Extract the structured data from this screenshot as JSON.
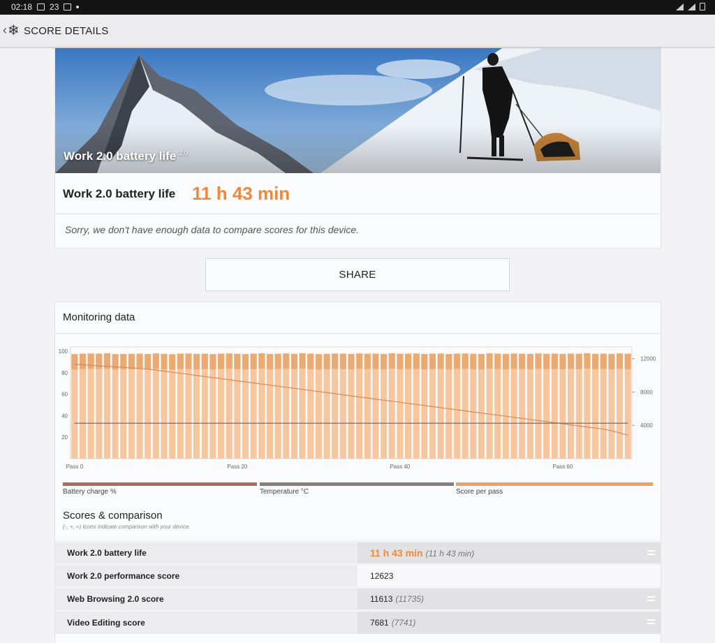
{
  "status_bar": {
    "time": "02:18",
    "notif_count": "23"
  },
  "app_bar": {
    "back_glyph": "‹",
    "logo_glyph": "❄",
    "title": "SCORE DETAILS"
  },
  "hero": {
    "caption": "Work 2.0 battery life",
    "caption_version": "2.0",
    "score_label": "Work 2.0 battery life",
    "score_value": "11 h 43 min",
    "compare_note": "Sorry, we don't have enough data to compare scores for this device."
  },
  "share": {
    "label": "SHARE"
  },
  "monitoring": {
    "title": "Monitoring data",
    "legend": [
      {
        "label": "Battery charge %",
        "color": "#a07060"
      },
      {
        "label": "Temperature °C",
        "color": "#8c7d7a"
      },
      {
        "label": "Score per pass",
        "color": "#f0a061"
      }
    ]
  },
  "chart_data": {
    "type": "bar",
    "x_tick_labels": [
      "Pass 0",
      "Pass 20",
      "Pass 40",
      "Pass 60"
    ],
    "x": [
      0,
      1,
      2,
      3,
      4,
      5,
      6,
      7,
      8,
      9,
      10,
      11,
      12,
      13,
      14,
      15,
      16,
      17,
      18,
      19,
      20,
      21,
      22,
      23,
      24,
      25,
      26,
      27,
      28,
      29,
      30,
      31,
      32,
      33,
      34,
      35,
      36,
      37,
      38,
      39,
      40,
      41,
      42,
      43,
      44,
      45,
      46,
      47,
      48,
      49,
      50,
      51,
      52,
      53,
      54,
      55,
      56,
      57,
      58,
      59,
      60,
      61,
      62,
      63,
      64,
      65,
      66,
      67,
      68
    ],
    "xlim": [
      -0.5,
      68.5
    ],
    "left_axis": {
      "ticks": [
        "100",
        "80",
        "60",
        "40",
        "20"
      ],
      "range": [
        0,
        104
      ]
    },
    "right_axis": {
      "ticks": [
        "12000",
        "8000",
        "4000"
      ],
      "range": [
        0,
        13400
      ]
    },
    "series": [
      {
        "name": "Score per pass",
        "axis": "right",
        "values": [
          12540,
          12590,
          12620,
          12600,
          12640,
          12540,
          12560,
          12580,
          12600,
          12550,
          12620,
          12570,
          12530,
          12600,
          12610,
          12560,
          12590,
          12540,
          12600,
          12620,
          12580,
          12550,
          12600,
          12640,
          12560,
          12590,
          12620,
          12580,
          12650,
          12600,
          12540,
          12570,
          12610,
          12590,
          12560,
          12620,
          12590,
          12600,
          12560,
          12640,
          12580,
          12600,
          12620,
          12560,
          12590,
          12610,
          12550,
          12600,
          12620,
          12580,
          12560,
          12640,
          12600,
          12570,
          12610,
          12590,
          12560,
          12620,
          12580,
          12600,
          12560,
          12610,
          12590,
          12650,
          12580,
          12600,
          12570,
          12620,
          12590
        ]
      },
      {
        "name": "Battery charge %",
        "axis": "left",
        "values": [
          88,
          87.5,
          87,
          86.5,
          86,
          85.5,
          85,
          84.5,
          84,
          83.3,
          82.5,
          81.5,
          80.5,
          79.5,
          78.5,
          77.5,
          76.5,
          75.5,
          74.5,
          73.5,
          72.5,
          71.5,
          70.5,
          69.5,
          68.5,
          67.5,
          66.5,
          65.5,
          64.5,
          63.5,
          62.5,
          61.5,
          60.5,
          59.5,
          58.5,
          57.5,
          56.5,
          55.5,
          54.5,
          53.5,
          52.5,
          51.5,
          50.5,
          49.5,
          48.5,
          47.5,
          46.5,
          45.5,
          44.5,
          43.5,
          42.5,
          41.5,
          40.5,
          39.5,
          38.5,
          37.5,
          36.5,
          35.5,
          34.5,
          33.5,
          32.5,
          31.5,
          30.5,
          29.5,
          28.5,
          27.5,
          26,
          24,
          22
        ]
      },
      {
        "name": "Temperature °C",
        "axis": "left",
        "values": [
          33,
          33,
          33,
          33,
          33,
          33,
          33,
          33,
          33,
          33,
          33,
          33,
          33,
          33,
          33,
          33,
          33,
          33,
          33,
          33,
          33,
          33,
          33,
          33,
          33,
          33,
          33,
          33,
          33,
          33,
          33,
          33,
          33,
          33,
          33,
          33,
          33,
          33,
          33,
          33,
          33,
          33,
          33,
          33,
          33,
          33,
          33,
          33,
          33,
          33,
          33,
          33,
          33,
          33,
          33,
          33,
          33,
          33,
          33,
          33,
          33,
          33,
          33,
          33,
          33,
          33,
          33,
          33,
          33
        ]
      }
    ],
    "grid": false
  },
  "scores": {
    "title": "Scores & comparison",
    "note": "(-, +, =) Icons indicate comparison with your device.",
    "rows": [
      {
        "name": "Work 2.0 battery life",
        "value": "11 h 43 min",
        "ref": "(11 h 43 min)"
      },
      {
        "name": "Work 2.0 performance score",
        "value": "12623",
        "ref": ""
      },
      {
        "name": "Web Browsing 2.0 score",
        "value": "11613",
        "ref": "(11735)"
      },
      {
        "name": "Video Editing score",
        "value": "7681",
        "ref": "(7741)"
      }
    ]
  }
}
